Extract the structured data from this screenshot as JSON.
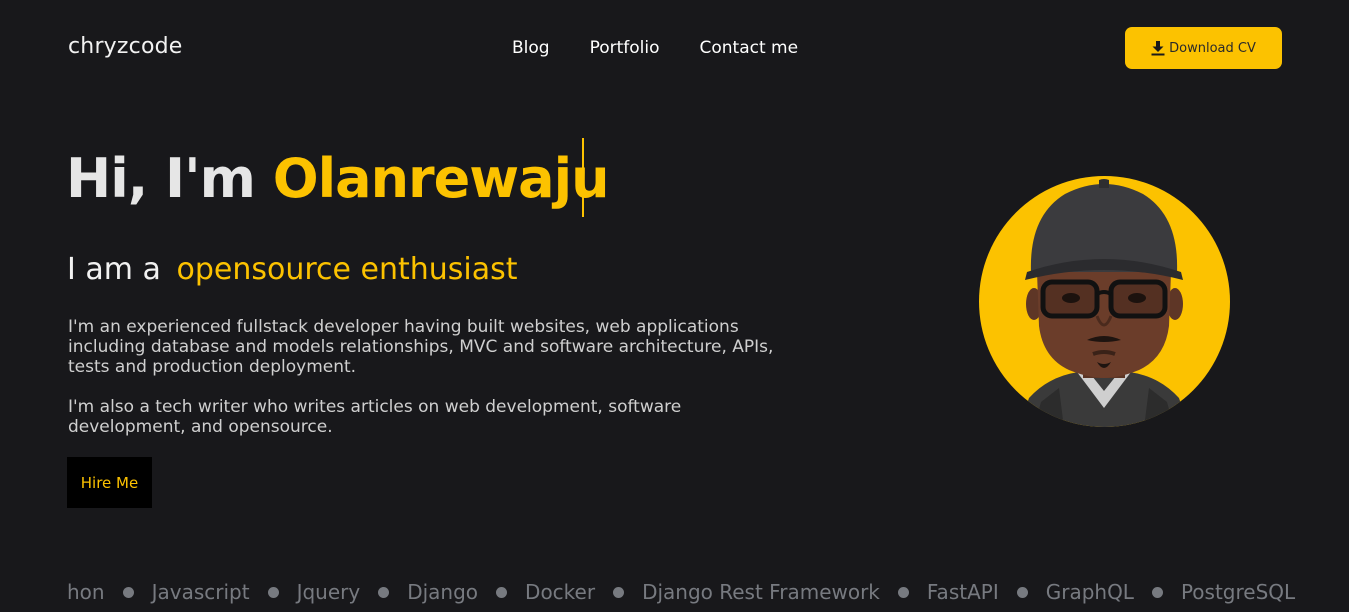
{
  "header": {
    "brand": "chryzcode",
    "nav": [
      {
        "label": "Blog"
      },
      {
        "label": "Portfolio"
      },
      {
        "label": "Contact me"
      }
    ],
    "download_label": "Download CV",
    "download_icon": "download-icon"
  },
  "hero": {
    "greeting": "Hi, I'm",
    "name": "Olanrewaju",
    "subtitle_prefix": "I am a",
    "subtitle_role": "opensource enthusiast",
    "paragraph_1": "I'm an experienced fullstack developer having built websites, web applications including database and models relationships, MVC and software architecture, APIs, tests and production deployment.",
    "paragraph_2": "I'm also a tech writer who writes articles on web development, software development, and opensource.",
    "hire_label": "Hire Me"
  },
  "skills": [
    "hon",
    "Javascript",
    "Jquery",
    "Django",
    "Docker",
    "Django Rest Framework",
    "FastAPI",
    "GraphQL",
    "PostgreSQL"
  ],
  "colors": {
    "background": "#18181b",
    "accent": "#fcc200",
    "muted": "#777a80"
  }
}
